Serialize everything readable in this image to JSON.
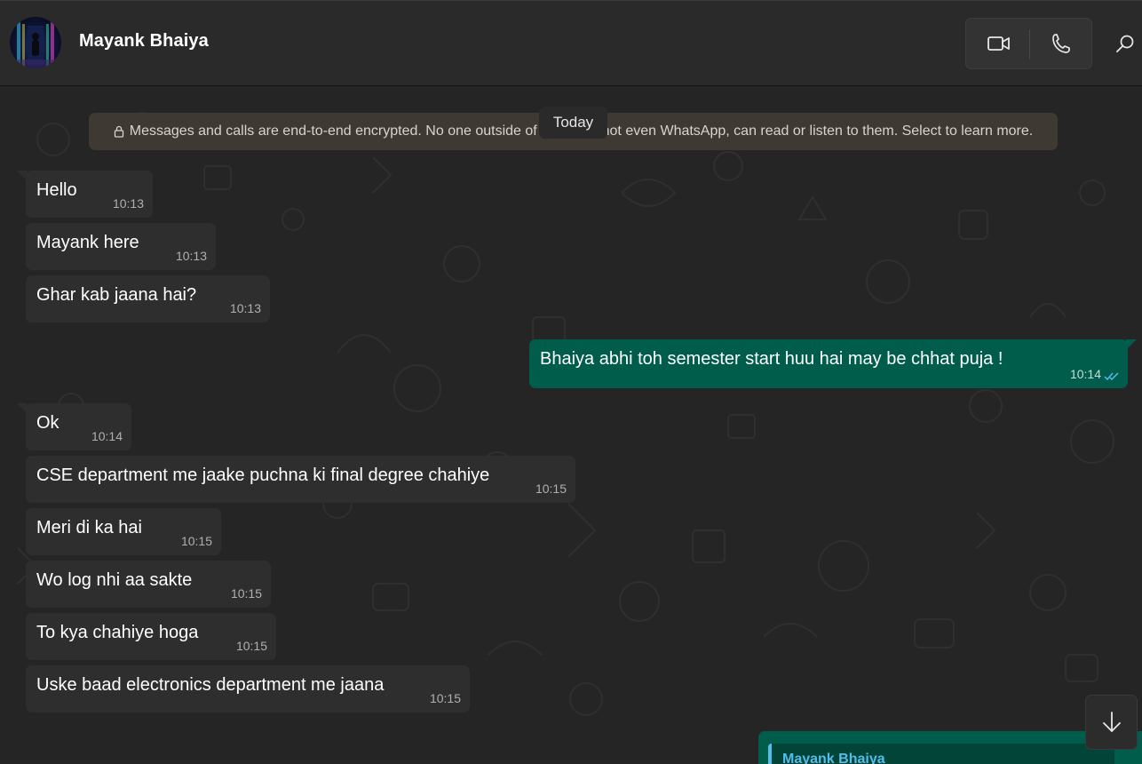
{
  "header": {
    "contact_name": "Mayank Bhaiya",
    "icons": [
      "video-call-icon",
      "voice-call-icon",
      "search-icon"
    ]
  },
  "chat": {
    "encryption_notice": "Messages and calls are end-to-end encrypted. No one outside of this chat, not even WhatsApp, can read or listen to them. Select to learn more.",
    "date_separator": "Today",
    "messages": [
      {
        "direction": "incoming",
        "text": "Hello",
        "time": "10:13"
      },
      {
        "direction": "incoming",
        "text": "Mayank here",
        "time": "10:13"
      },
      {
        "direction": "incoming",
        "text": "Ghar kab jaana hai?",
        "time": "10:13"
      },
      {
        "direction": "outgoing",
        "text": "Bhaiya  abhi toh semester start huu hai  may be chhat puja !",
        "time": "10:14",
        "status": "read"
      },
      {
        "direction": "incoming",
        "text": "Ok",
        "time": "10:14"
      },
      {
        "direction": "incoming",
        "text": "CSE department me jaake puchna ki final degree chahiye",
        "time": "10:15"
      },
      {
        "direction": "incoming",
        "text": "Meri di ka hai",
        "time": "10:15"
      },
      {
        "direction": "incoming",
        "text": "Wo log nhi aa sakte",
        "time": "10:15"
      },
      {
        "direction": "incoming",
        "text": "To kya chahiye hoga",
        "time": "10:15"
      },
      {
        "direction": "incoming",
        "text": "Uske baad electronics department me jaana",
        "time": "10:15"
      }
    ],
    "partial_reply": {
      "quoted_author": "Mayank Bhaiya"
    },
    "scroll_button_icon": "arrow-down-icon"
  },
  "colors": {
    "header_bg": "#2a2a2a",
    "chat_bg": "#252525",
    "incoming_bubble": "#2e2e2e",
    "outgoing_bubble": "#005c4b",
    "read_ticks": "#53bdeb",
    "quote_accent": "#53bdeb"
  }
}
